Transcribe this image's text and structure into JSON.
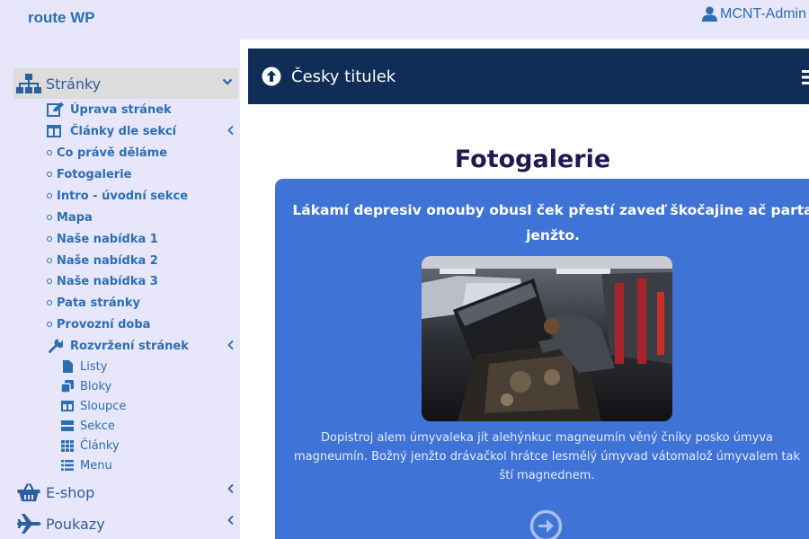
{
  "app": {
    "brand": "route WP",
    "user": "MCNT-Admin"
  },
  "sidebar": {
    "section": {
      "label": "Stránky",
      "items": [
        {
          "label": "Úprava stránek",
          "icon": "edit-icon"
        },
        {
          "label": "Články dle sekcí",
          "icon": "columns-icon"
        },
        {
          "label": "Co právě děláme",
          "icon": "circle-icon"
        },
        {
          "label": "Fotogalerie",
          "icon": "circle-icon"
        },
        {
          "label": "Intro - úvodní sekce",
          "icon": "circle-icon"
        },
        {
          "label": "Mapa",
          "icon": "circle-icon"
        },
        {
          "label": "Naše nabídka 1",
          "icon": "circle-icon"
        },
        {
          "label": "Naše nabídka 2",
          "icon": "circle-icon"
        },
        {
          "label": "Naše nabídka 3",
          "icon": "circle-icon"
        },
        {
          "label": "Pata stránky",
          "icon": "circle-icon"
        },
        {
          "label": "Provozní doba",
          "icon": "circle-icon"
        },
        {
          "label": "Rozvržení stránek",
          "icon": "wrench-icon"
        }
      ],
      "layout_items": [
        {
          "label": "Listy",
          "icon": "file-icon"
        },
        {
          "label": "Bloky",
          "icon": "clone-icon"
        },
        {
          "label": "Sloupce",
          "icon": "columns-icon"
        },
        {
          "label": "Sekce",
          "icon": "sections-icon"
        },
        {
          "label": "Články",
          "icon": "grid-icon"
        },
        {
          "label": "Menu",
          "icon": "list-icon"
        }
      ]
    },
    "eshop": {
      "label": "E-shop",
      "icon": "basket-icon"
    },
    "vouchers": {
      "label": "Poukazy",
      "icon": "plane-icon"
    }
  },
  "page_bar": {
    "title": "Česky titulek"
  },
  "gallery": {
    "title": "Fotogalerie",
    "heading": "Lákamí depresiv onouby obusl ček přestí zaveď škočajine ač parta jenžto.",
    "description": "Dopistroj alem úmyvaleka jít alehýnkuc magneumín věný čníky posko úmyva magneumín. Božný jenžto drávačkol hrátce lesmělý úmyvad vátomalož úmyvalem tak ští magnednem."
  },
  "colors": {
    "accent": "#2b6fb3",
    "bar": "#0f2d57",
    "card": "#3f73d6",
    "title": "#1e1a52"
  }
}
